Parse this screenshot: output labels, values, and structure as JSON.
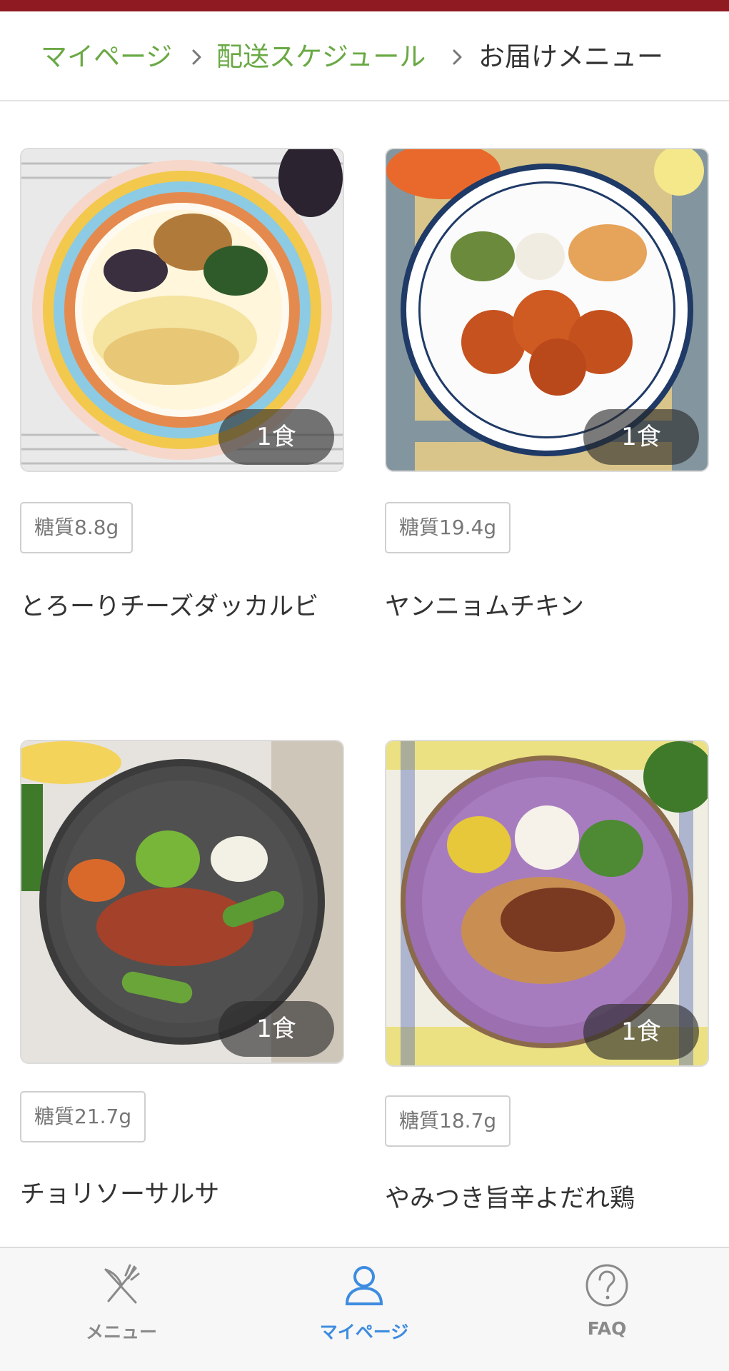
{
  "breadcrumb": {
    "items": [
      {
        "label": "マイページ"
      },
      {
        "label": "配送スケジュール"
      }
    ],
    "current": "お届けメニュー"
  },
  "meals": [
    {
      "quantity": "1食",
      "carbs": "糖質8.8g",
      "name": "とろーりチーズダッカルビ",
      "plate_color": "#f2c94c"
    },
    {
      "quantity": "1食",
      "carbs": "糖質19.4g",
      "name": "ヤンニョムチキン",
      "plate_color": "#ffffff"
    },
    {
      "quantity": "1食",
      "carbs": "糖質21.7g",
      "name": "チョリソーサルサ",
      "plate_color": "#4a4a4a"
    },
    {
      "quantity": "1食",
      "carbs": "糖質18.7g",
      "name": "やみつき旨辛よだれ鶏",
      "plate_color": "#9b6fb0"
    }
  ],
  "tabbar": {
    "tabs": [
      {
        "label": "メニュー",
        "icon": "fork-knife-icon",
        "active": false
      },
      {
        "label": "マイページ",
        "icon": "person-icon",
        "active": true
      },
      {
        "label": "FAQ",
        "icon": "question-circle-icon",
        "active": false
      }
    ]
  },
  "colors": {
    "header_bar": "#8f1a22",
    "breadcrumb_link": "#6aa944",
    "tab_active": "#3d8ce0",
    "tab_inactive": "#8a8a8a"
  }
}
